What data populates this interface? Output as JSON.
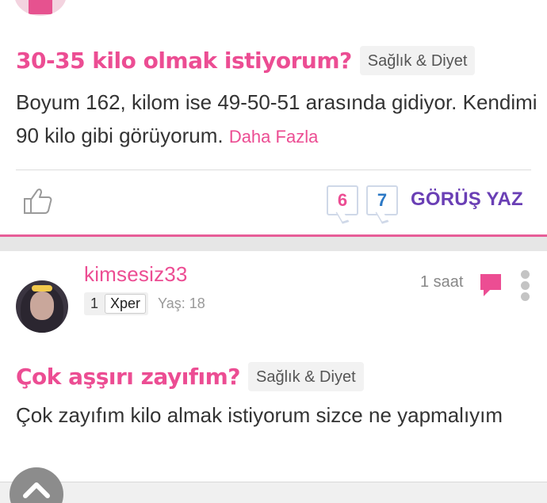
{
  "post1": {
    "title": "30-35 kilo olmak istiyorum?",
    "category": "Sağlık & Diyet",
    "body": "Boyum 162, kilom ise 49-50-51 arasında gidiyor. Kendimi 90 kilo gibi görüyorum.",
    "more_link": "Daha Fazla",
    "count_pink": "6",
    "count_blue": "7",
    "action_label": "GÖRÜŞ YAZ"
  },
  "post2": {
    "username": "kimsesiz33",
    "level": "1",
    "level_title": "Xper",
    "age": "Yaş: 18",
    "time": "1 saat",
    "title": "Çok aşşırı zayıfım?",
    "category": "Sağlık & Diyet",
    "body": "Çok zayıfım kilo almak istiyorum sizce ne yapmalıyım"
  },
  "colors": {
    "accent_pink": "#ec4d93",
    "accent_purple": "#6a3fb5",
    "accent_blue": "#2b78c5"
  },
  "icons": {
    "like": "thumbs-up-icon",
    "comment": "comment-icon",
    "more": "more-vertical-icon",
    "scroll_top": "chevron-up-icon"
  }
}
